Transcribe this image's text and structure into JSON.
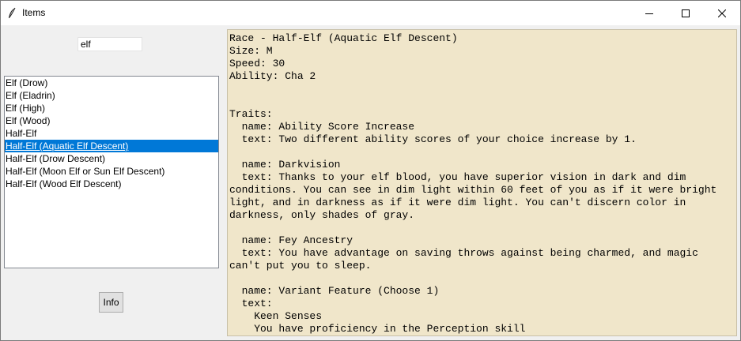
{
  "window": {
    "title": "Items"
  },
  "search": {
    "value": "elf"
  },
  "list": {
    "items": [
      "Elf (Drow)",
      "Elf (Eladrin)",
      "Elf (High)",
      "Elf (Wood)",
      "Half-Elf",
      "Half-Elf (Aquatic Elf Descent)",
      "Half-Elf (Drow Descent)",
      "Half-Elf (Moon Elf or Sun Elf Descent)",
      "Half-Elf (Wood Elf Descent)"
    ],
    "selected_index": 5
  },
  "info_button": {
    "label": "Info"
  },
  "details": {
    "lines": [
      "Race - Half-Elf (Aquatic Elf Descent)",
      "Size: M",
      "Speed: 30",
      "Ability: Cha 2",
      "",
      "",
      "Traits:",
      "  name: Ability Score Increase",
      "  text: Two different ability scores of your choice increase by 1.",
      "",
      "  name: Darkvision",
      "  text: Thanks to your elf blood, you have superior vision in dark and dim",
      "conditions. You can see in dim light within 60 feet of you as if it were bright",
      "light, and in darkness as if it were dim light. You can't discern color in",
      "darkness, only shades of gray.",
      "",
      "  name: Fey Ancestry",
      "  text: You have advantage on saving throws against being charmed, and magic",
      "can't put you to sleep.",
      "",
      "  name: Variant Feature (Choose 1)",
      "  text:",
      "    Keen Senses",
      "    You have proficiency in the Perception skill"
    ]
  },
  "icons": {
    "app": "feather-icon",
    "minimize": "minimize-icon",
    "maximize": "maximize-icon",
    "close": "close-icon"
  },
  "colors": {
    "selection": "#0078d7",
    "text_panel_bg": "#f0e6ca",
    "window_bg": "#f0f0f0"
  }
}
